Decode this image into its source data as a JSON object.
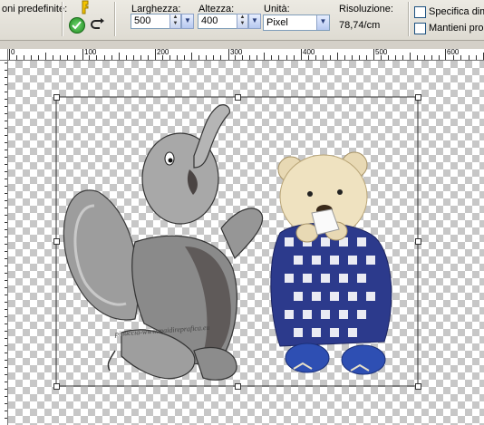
{
  "toolbar": {
    "presets_label": "oni predefinite:",
    "width_label": "Larghezza:",
    "width_value": "500",
    "height_label": "Altezza:",
    "height_value": "400",
    "units_label": "Unità:",
    "units_value": "Pixel",
    "resolution_label": "Risoluzione:",
    "resolution_value": "78,74/cm",
    "specify_label": "Specifica dimer",
    "maintain_label": "Mantieni propo"
  },
  "ruler": {
    "labels": [
      "0",
      "100",
      "200",
      "300",
      "400",
      "500",
      "600"
    ]
  },
  "canvas": {
    "watermark": "pinuccia-www.maidireprafica.eu",
    "objects": [
      "elephant",
      "teddy-bear"
    ]
  },
  "colors": {
    "accept": "#2e9b2e",
    "accent": "#2a3f7a",
    "checker": "#c7c7c7"
  }
}
